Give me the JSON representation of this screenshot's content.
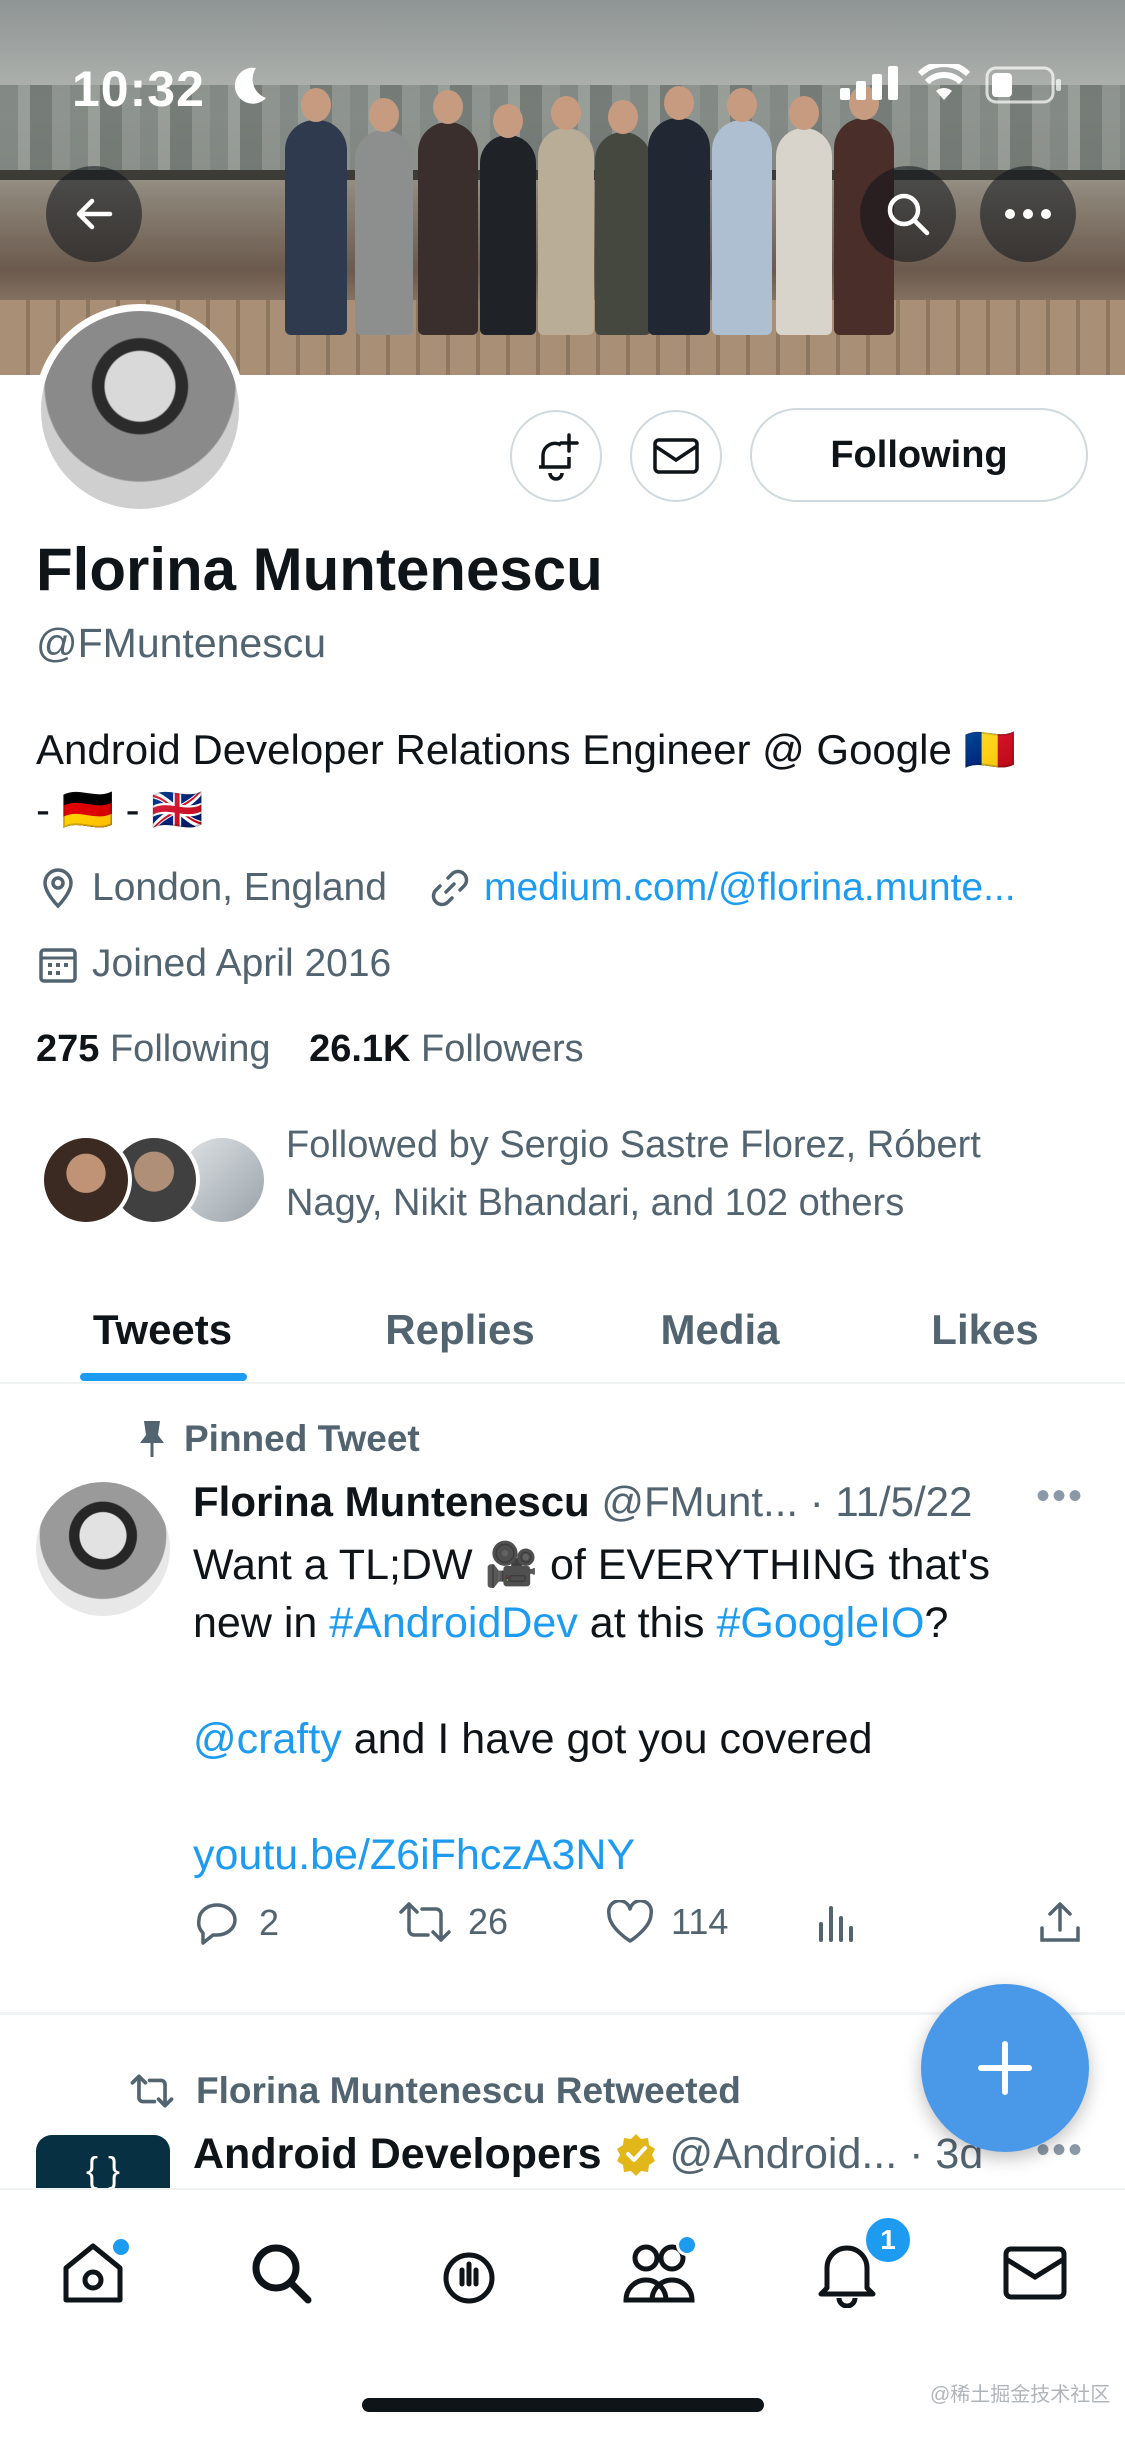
{
  "status_bar": {
    "time": "10:32"
  },
  "profile": {
    "name": "Florina Muntenescu",
    "handle": "@FMuntenescu",
    "bio_line1": "Android Developer Relations Engineer @ Google 🇷🇴",
    "bio_line2": "- 🇩🇪 - 🇬🇧",
    "location": "London, England",
    "website": "medium.com/@florina.munte...",
    "joined": "Joined April 2016",
    "following_count": "275",
    "following_label": "Following",
    "followers_count": "26.1K",
    "followers_label": "Followers",
    "followed_by": "Followed by Sergio Sastre Florez, Róbert Nagy, Nikit Bhandari, and 102 others",
    "follow_button": "Following"
  },
  "tabs": [
    "Tweets",
    "Replies",
    "Media",
    "Likes"
  ],
  "pinned_tweet": {
    "label": "Pinned Tweet",
    "author": "Florina Muntenescu",
    "handle": "@FMunt...",
    "date": "· 11/5/22",
    "text_a": "Want a TL;DW 🎥 of EVERYTHING that's new in ",
    "hashtag1": "#AndroidDev",
    "text_b": " at this ",
    "hashtag2": "#GoogleIO",
    "text_c": "?",
    "mention": "@crafty",
    "text_d": " and I have got you covered",
    "link": "youtu.be/Z6iFhczA3NY",
    "replies": "2",
    "retweets": "26",
    "likes": "114"
  },
  "retweet_item": {
    "label": "Florina Muntenescu Retweeted",
    "author": "Android Developers",
    "handle": "@Android...",
    "date": "· 3d",
    "avatar_text": "{ }"
  },
  "bottom_nav": {
    "notifications_badge": "1"
  },
  "watermark": "@稀土掘金技术社区",
  "colors": {
    "accent": "#1d9bf0",
    "text": "#0f1419",
    "muted": "#536471",
    "fab": "#4a99e9",
    "verified": "#e2b719"
  }
}
